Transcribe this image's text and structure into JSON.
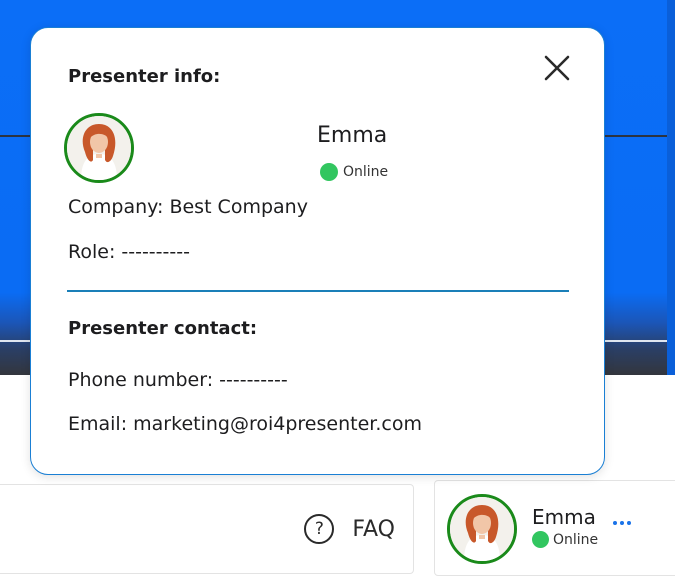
{
  "faq": {
    "icon": "question-circle-icon",
    "icon_glyph": "?",
    "label": "FAQ"
  },
  "presenter_card": {
    "name": "Emma",
    "status": "Online",
    "avatar_icon": "presenter-avatar"
  },
  "popup": {
    "info_heading": "Presenter info:",
    "name": "Emma",
    "status": "Online",
    "company": "Company: Best Company",
    "role": "Role: ----------",
    "contact_heading": "Presenter contact:",
    "phone": "Phone number: ----------",
    "email": "Email: marketing@roi4presenter.com",
    "close_icon": "close-icon"
  },
  "colors": {
    "primary_blue": "#0b6ef7",
    "online_green": "#32c660",
    "avatar_ring": "#1a8a1a",
    "divider": "#1a7fb8",
    "accent_dots": "#1a73e8"
  }
}
